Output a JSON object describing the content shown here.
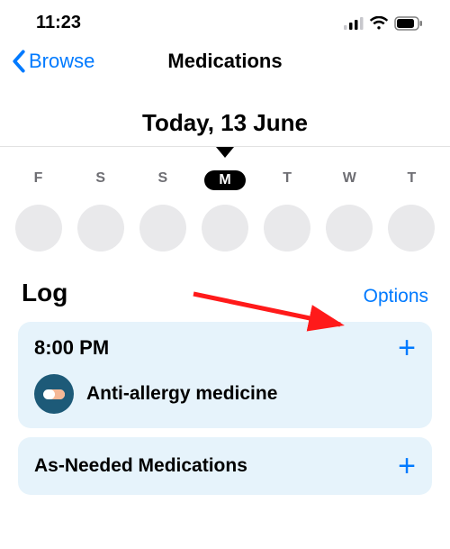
{
  "status": {
    "time": "11:23"
  },
  "nav": {
    "back_label": "Browse",
    "title": "Medications"
  },
  "date": "Today, 13 June",
  "weekdays": [
    "F",
    "S",
    "S",
    "M",
    "T",
    "W",
    "T"
  ],
  "selected_day_index": 3,
  "log": {
    "heading": "Log",
    "options_label": "Options",
    "groups": [
      {
        "time_label": "8:00 PM",
        "items": [
          {
            "name": "Anti-allergy medicine",
            "icon": "pill-capsule"
          }
        ]
      }
    ],
    "as_needed_label": "As-Needed Medications"
  }
}
